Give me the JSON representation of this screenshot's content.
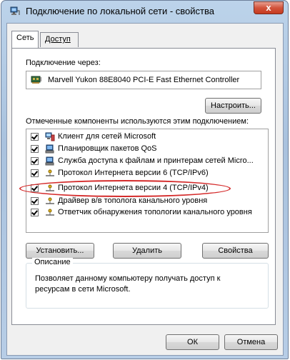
{
  "window": {
    "title": "Подключение по локальной сети - свойства",
    "close_label": "x"
  },
  "tabs": [
    {
      "label": "Сеть",
      "active": true
    },
    {
      "label": "Доступ",
      "active": false
    }
  ],
  "connection": {
    "label": "Подключение через:",
    "adapter_name": "Marvell Yukon 88E8040 PCI-E Fast Ethernet Controller",
    "configure_button": "Настроить..."
  },
  "components": {
    "label": "Отмеченные компоненты используются этим подключением:",
    "items": [
      {
        "label": "Клиент для сетей Microsoft",
        "checked": true,
        "icon": "network-client-icon"
      },
      {
        "label": "Планировщик пакетов QoS",
        "checked": true,
        "icon": "service-icon"
      },
      {
        "label": "Служба доступа к файлам и принтерам сетей Micro...",
        "checked": true,
        "icon": "service-icon"
      },
      {
        "label": "Протокол Интернета версии 6 (TCP/IPv6)",
        "checked": true,
        "icon": "protocol-icon"
      },
      {
        "label": "Протокол Интернета версии 4 (TCP/IPv4)",
        "checked": true,
        "icon": "protocol-icon"
      },
      {
        "label": "Драйвер в/в тополога канального уровня",
        "checked": true,
        "icon": "protocol-icon"
      },
      {
        "label": "Ответчик обнаружения топологии канального уровня",
        "checked": true,
        "icon": "protocol-icon"
      }
    ]
  },
  "actions": {
    "install": "Установить...",
    "remove": "Удалить",
    "properties": "Свойства"
  },
  "description": {
    "legend": "Описание",
    "text": "Позволяет данному компьютеру получать доступ к ресурсам в сети Microsoft."
  },
  "footer": {
    "ok": "ОК",
    "cancel": "Отмена"
  },
  "colors": {
    "highlight_ellipse": "#d42a2a",
    "close_button": "#c63a1f"
  }
}
